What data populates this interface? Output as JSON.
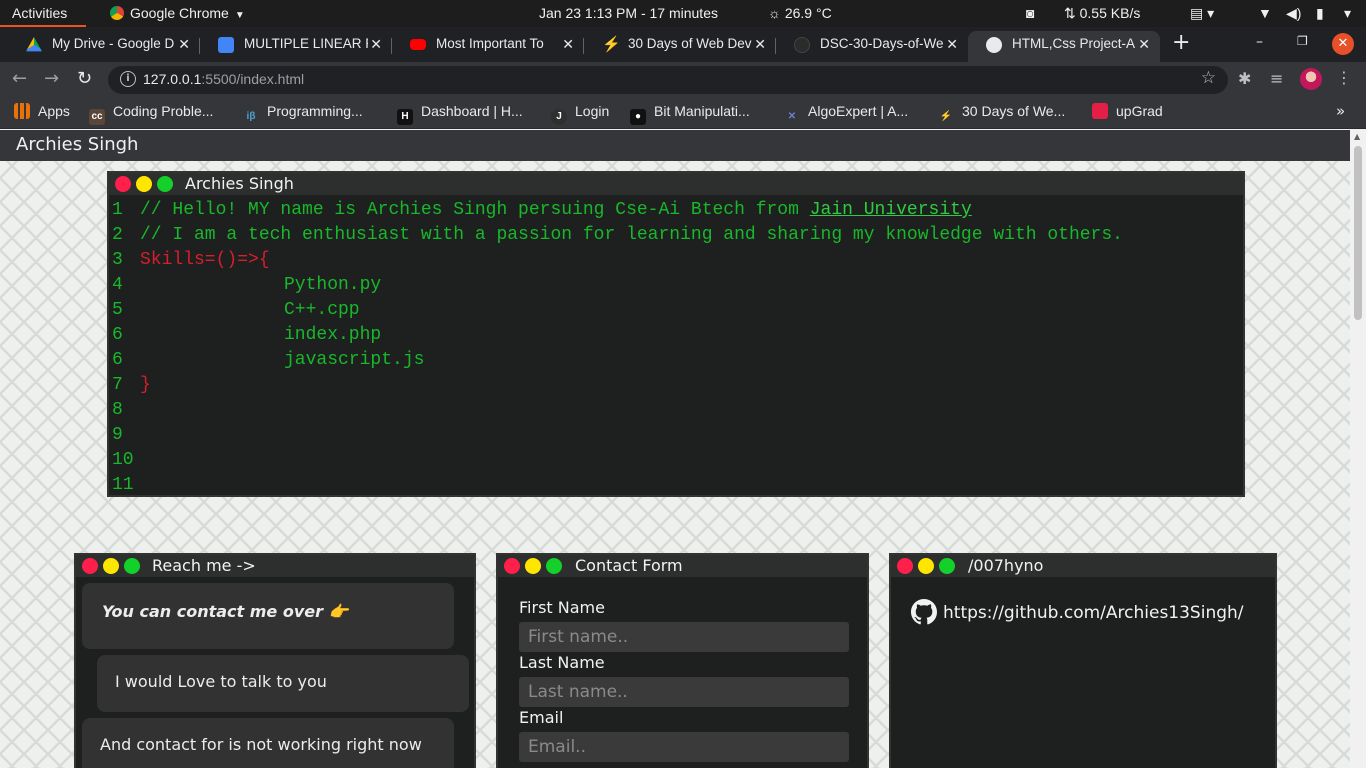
{
  "topbar": {
    "activities": "Activities",
    "app_name": "Google Chrome",
    "clock": "Jan 23   1:13 PM - 17 minutes",
    "weather": "26.9 °C",
    "network": "0.55 KB/s"
  },
  "tabs": [
    {
      "title": "My Drive - Google D",
      "icon": "google-drive-icon",
      "color": "#fbbc04"
    },
    {
      "title": "MULTIPLE LINEAR R",
      "icon": "google-docs-icon",
      "color": "#4285f4"
    },
    {
      "title": "Most Important To",
      "icon": "youtube-icon",
      "color": "#ff0000"
    },
    {
      "title": "30 Days of Web Dev",
      "icon": "lightning-icon",
      "color": "#7b2ff7"
    },
    {
      "title": "DSC-30-Days-of-We",
      "icon": "github-icon",
      "color": "#24292e"
    },
    {
      "title": "HTML,Css Project-A",
      "icon": "globe-icon",
      "color": "#e8eaed",
      "active": true
    }
  ],
  "address_bar": {
    "host": "127.0.0.1",
    "path": ":5500/index.html"
  },
  "bookmarks": [
    {
      "label": "Apps",
      "icon": "apps-grid-icon",
      "color": "#e8710a"
    },
    {
      "label": "Coding Proble...",
      "icon": "codechef-icon",
      "color": "#5b4638"
    },
    {
      "label": "Programming...",
      "icon": "interviewbit-icon",
      "color": "#4da3d5"
    },
    {
      "label": "Dashboard | H...",
      "icon": "hackerrank-icon",
      "color": "#111111"
    },
    {
      "label": "Login",
      "icon": "gfg-icon",
      "color": "#2f2f2f"
    },
    {
      "label": "Bit Manipulati...",
      "icon": "leetcode-icon",
      "color": "#111111"
    },
    {
      "label": "AlgoExpert | A...",
      "icon": "algoexpert-icon",
      "color": "#3d4a8a"
    },
    {
      "label": "30 Days of We...",
      "icon": "lightning-icon",
      "color": "#7b2ff7"
    },
    {
      "label": "upGrad",
      "icon": "upgrad-icon",
      "color": "#e41f47"
    }
  ],
  "site": {
    "header_title": "Archies Singh"
  },
  "code_window": {
    "title": "Archies Singh",
    "lines": [
      {
        "n": "1",
        "text": "// Hello! MY name is Archies Singh persuing Cse-Ai Btech from ",
        "link": "Jain University"
      },
      {
        "n": "2",
        "text": "// I am a tech enthusiast with a passion for learning and sharing my knowledge with others."
      },
      {
        "n": "3",
        "text": "Skills=()=>{"
      },
      {
        "n": "4",
        "text": "Python.py"
      },
      {
        "n": "5",
        "text": "C++.cpp"
      },
      {
        "n": "6",
        "text": "index.php"
      },
      {
        "n": "6",
        "text": "javascript.js"
      },
      {
        "n": "7",
        "text": "}"
      },
      {
        "n": "8",
        "text": ""
      },
      {
        "n": "9",
        "text": ""
      },
      {
        "n": "10",
        "text": ""
      },
      {
        "n": "11",
        "text": ""
      }
    ]
  },
  "reach_window": {
    "title": "Reach me ->",
    "bubble1": "You can contact me over 👉",
    "bubble2": "I would Love to talk to you",
    "bubble3": "And contact for is not working right now"
  },
  "form_window": {
    "title": "Contact Form",
    "first_label": "First Name",
    "first_placeholder": "First name..",
    "last_label": "Last  Name",
    "last_placeholder": "Last name..",
    "email_label": "Email",
    "email_placeholder": "Email.."
  },
  "github_window": {
    "title": "/007hyno",
    "link": "https://github.com/Archies13Singh/"
  },
  "colors": {
    "code_green": "#18b82b",
    "code_red": "#d81f2c",
    "dot_red": "#ff1f4b",
    "dot_yellow": "#ffe600",
    "dot_green": "#13d02a"
  }
}
